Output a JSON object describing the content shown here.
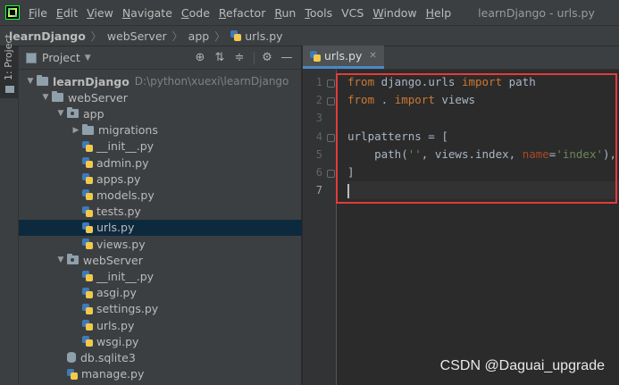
{
  "window": {
    "title": "learnDjango - urls.py"
  },
  "menu": [
    {
      "first": "F",
      "rest": "ile"
    },
    {
      "first": "E",
      "rest": "dit"
    },
    {
      "first": "V",
      "rest": "iew"
    },
    {
      "first": "N",
      "rest": "avigate"
    },
    {
      "first": "C",
      "rest": "ode"
    },
    {
      "first": "R",
      "rest": "efactor"
    },
    {
      "first": "R",
      "rest": "un"
    },
    {
      "first": "T",
      "rest": "ools"
    },
    {
      "first": "",
      "rest": "VCS"
    },
    {
      "first": "W",
      "rest": "indow"
    },
    {
      "first": "H",
      "rest": "elp"
    }
  ],
  "breadcrumb": [
    "learnDjango",
    "webServer",
    "app",
    "urls.py"
  ],
  "toolstrip": {
    "label": "1: Project"
  },
  "project": {
    "title": "Project",
    "tree": [
      {
        "label": "learnDjango",
        "path": "D:\\python\\xuexi\\learnDjango",
        "depth": 0,
        "type": "folder",
        "expanded": true
      },
      {
        "label": "webServer",
        "depth": 1,
        "type": "folder",
        "expanded": true
      },
      {
        "label": "app",
        "depth": 2,
        "type": "pkg",
        "expanded": true
      },
      {
        "label": "migrations",
        "depth": 3,
        "type": "folder",
        "expanded": false
      },
      {
        "label": "__init__.py",
        "depth": 3,
        "type": "py"
      },
      {
        "label": "admin.py",
        "depth": 3,
        "type": "py"
      },
      {
        "label": "apps.py",
        "depth": 3,
        "type": "py"
      },
      {
        "label": "models.py",
        "depth": 3,
        "type": "py"
      },
      {
        "label": "tests.py",
        "depth": 3,
        "type": "py"
      },
      {
        "label": "urls.py",
        "depth": 3,
        "type": "py",
        "selected": true
      },
      {
        "label": "views.py",
        "depth": 3,
        "type": "py"
      },
      {
        "label": "webServer",
        "depth": 2,
        "type": "pkg",
        "expanded": true
      },
      {
        "label": "__init__.py",
        "depth": 3,
        "type": "py"
      },
      {
        "label": "asgi.py",
        "depth": 3,
        "type": "py"
      },
      {
        "label": "settings.py",
        "depth": 3,
        "type": "py"
      },
      {
        "label": "urls.py",
        "depth": 3,
        "type": "py"
      },
      {
        "label": "wsgi.py",
        "depth": 3,
        "type": "py"
      },
      {
        "label": "db.sqlite3",
        "depth": 2,
        "type": "db"
      },
      {
        "label": "manage.py",
        "depth": 2,
        "type": "py"
      }
    ]
  },
  "editor": {
    "tab": "urls.py",
    "lines": [
      {
        "no": "1",
        "tokens": [
          {
            "t": "from",
            "c": "kw"
          },
          {
            "t": " django.urls ",
            "c": ""
          },
          {
            "t": "import",
            "c": "kw"
          },
          {
            "t": " path",
            "c": ""
          }
        ]
      },
      {
        "no": "2",
        "tokens": [
          {
            "t": "from",
            "c": "kw"
          },
          {
            "t": " . ",
            "c": ""
          },
          {
            "t": "import",
            "c": "kw"
          },
          {
            "t": " views",
            "c": ""
          }
        ]
      },
      {
        "no": "3",
        "tokens": []
      },
      {
        "no": "4",
        "tokens": [
          {
            "t": "urlpatterns = [",
            "c": ""
          }
        ]
      },
      {
        "no": "5",
        "tokens": [
          {
            "t": "    path(",
            "c": ""
          },
          {
            "t": "''",
            "c": "str"
          },
          {
            "t": ", views.index, ",
            "c": ""
          },
          {
            "t": "name",
            "c": "param"
          },
          {
            "t": "=",
            "c": ""
          },
          {
            "t": "'index'",
            "c": "str"
          },
          {
            "t": "),",
            "c": ""
          }
        ]
      },
      {
        "no": "6",
        "tokens": [
          {
            "t": "]",
            "c": ""
          }
        ]
      },
      {
        "no": "7",
        "tokens": [],
        "current": true
      }
    ]
  },
  "watermark": "CSDN @Daguai_upgrade"
}
